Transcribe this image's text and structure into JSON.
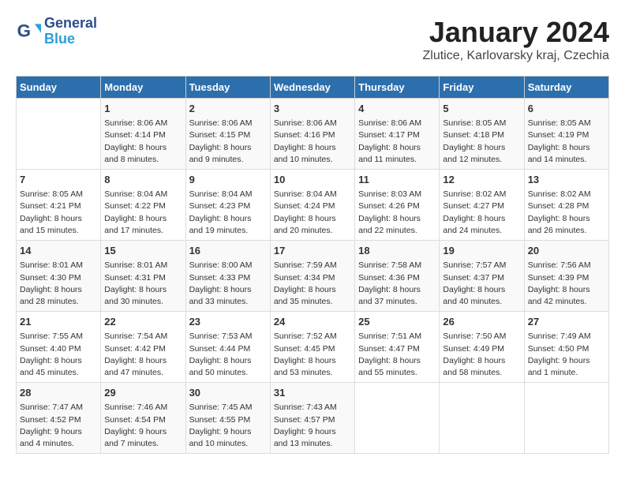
{
  "logo": {
    "line1": "General",
    "line2": "Blue"
  },
  "title": "January 2024",
  "subtitle": "Zlutice, Karlovarsky kraj, Czechia",
  "headers": [
    "Sunday",
    "Monday",
    "Tuesday",
    "Wednesday",
    "Thursday",
    "Friday",
    "Saturday"
  ],
  "weeks": [
    [
      {
        "day": "",
        "info": ""
      },
      {
        "day": "1",
        "info": "Sunrise: 8:06 AM\nSunset: 4:14 PM\nDaylight: 8 hours\nand 8 minutes."
      },
      {
        "day": "2",
        "info": "Sunrise: 8:06 AM\nSunset: 4:15 PM\nDaylight: 8 hours\nand 9 minutes."
      },
      {
        "day": "3",
        "info": "Sunrise: 8:06 AM\nSunset: 4:16 PM\nDaylight: 8 hours\nand 10 minutes."
      },
      {
        "day": "4",
        "info": "Sunrise: 8:06 AM\nSunset: 4:17 PM\nDaylight: 8 hours\nand 11 minutes."
      },
      {
        "day": "5",
        "info": "Sunrise: 8:05 AM\nSunset: 4:18 PM\nDaylight: 8 hours\nand 12 minutes."
      },
      {
        "day": "6",
        "info": "Sunrise: 8:05 AM\nSunset: 4:19 PM\nDaylight: 8 hours\nand 14 minutes."
      }
    ],
    [
      {
        "day": "7",
        "info": "Sunrise: 8:05 AM\nSunset: 4:21 PM\nDaylight: 8 hours\nand 15 minutes."
      },
      {
        "day": "8",
        "info": "Sunrise: 8:04 AM\nSunset: 4:22 PM\nDaylight: 8 hours\nand 17 minutes."
      },
      {
        "day": "9",
        "info": "Sunrise: 8:04 AM\nSunset: 4:23 PM\nDaylight: 8 hours\nand 19 minutes."
      },
      {
        "day": "10",
        "info": "Sunrise: 8:04 AM\nSunset: 4:24 PM\nDaylight: 8 hours\nand 20 minutes."
      },
      {
        "day": "11",
        "info": "Sunrise: 8:03 AM\nSunset: 4:26 PM\nDaylight: 8 hours\nand 22 minutes."
      },
      {
        "day": "12",
        "info": "Sunrise: 8:02 AM\nSunset: 4:27 PM\nDaylight: 8 hours\nand 24 minutes."
      },
      {
        "day": "13",
        "info": "Sunrise: 8:02 AM\nSunset: 4:28 PM\nDaylight: 8 hours\nand 26 minutes."
      }
    ],
    [
      {
        "day": "14",
        "info": "Sunrise: 8:01 AM\nSunset: 4:30 PM\nDaylight: 8 hours\nand 28 minutes."
      },
      {
        "day": "15",
        "info": "Sunrise: 8:01 AM\nSunset: 4:31 PM\nDaylight: 8 hours\nand 30 minutes."
      },
      {
        "day": "16",
        "info": "Sunrise: 8:00 AM\nSunset: 4:33 PM\nDaylight: 8 hours\nand 33 minutes."
      },
      {
        "day": "17",
        "info": "Sunrise: 7:59 AM\nSunset: 4:34 PM\nDaylight: 8 hours\nand 35 minutes."
      },
      {
        "day": "18",
        "info": "Sunrise: 7:58 AM\nSunset: 4:36 PM\nDaylight: 8 hours\nand 37 minutes."
      },
      {
        "day": "19",
        "info": "Sunrise: 7:57 AM\nSunset: 4:37 PM\nDaylight: 8 hours\nand 40 minutes."
      },
      {
        "day": "20",
        "info": "Sunrise: 7:56 AM\nSunset: 4:39 PM\nDaylight: 8 hours\nand 42 minutes."
      }
    ],
    [
      {
        "day": "21",
        "info": "Sunrise: 7:55 AM\nSunset: 4:40 PM\nDaylight: 8 hours\nand 45 minutes."
      },
      {
        "day": "22",
        "info": "Sunrise: 7:54 AM\nSunset: 4:42 PM\nDaylight: 8 hours\nand 47 minutes."
      },
      {
        "day": "23",
        "info": "Sunrise: 7:53 AM\nSunset: 4:44 PM\nDaylight: 8 hours\nand 50 minutes."
      },
      {
        "day": "24",
        "info": "Sunrise: 7:52 AM\nSunset: 4:45 PM\nDaylight: 8 hours\nand 53 minutes."
      },
      {
        "day": "25",
        "info": "Sunrise: 7:51 AM\nSunset: 4:47 PM\nDaylight: 8 hours\nand 55 minutes."
      },
      {
        "day": "26",
        "info": "Sunrise: 7:50 AM\nSunset: 4:49 PM\nDaylight: 8 hours\nand 58 minutes."
      },
      {
        "day": "27",
        "info": "Sunrise: 7:49 AM\nSunset: 4:50 PM\nDaylight: 9 hours\nand 1 minute."
      }
    ],
    [
      {
        "day": "28",
        "info": "Sunrise: 7:47 AM\nSunset: 4:52 PM\nDaylight: 9 hours\nand 4 minutes."
      },
      {
        "day": "29",
        "info": "Sunrise: 7:46 AM\nSunset: 4:54 PM\nDaylight: 9 hours\nand 7 minutes."
      },
      {
        "day": "30",
        "info": "Sunrise: 7:45 AM\nSunset: 4:55 PM\nDaylight: 9 hours\nand 10 minutes."
      },
      {
        "day": "31",
        "info": "Sunrise: 7:43 AM\nSunset: 4:57 PM\nDaylight: 9 hours\nand 13 minutes."
      },
      {
        "day": "",
        "info": ""
      },
      {
        "day": "",
        "info": ""
      },
      {
        "day": "",
        "info": ""
      }
    ]
  ]
}
